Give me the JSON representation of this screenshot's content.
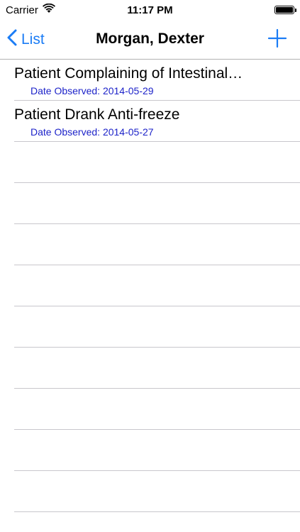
{
  "status_bar": {
    "carrier": "Carrier",
    "time": "11:17 PM",
    "battery_level": 1.0
  },
  "nav": {
    "back_label": "List",
    "title": "Morgan, Dexter",
    "accent_color": "#1b7cf5",
    "add_icon": "plus-icon"
  },
  "observations": [
    {
      "title": "Patient Complaining of Intestinal…",
      "subtitle": "Date Observed: 2014-05-29"
    },
    {
      "title": "Patient Drank Anti-freeze",
      "subtitle": "Date Observed: 2014-05-27"
    }
  ],
  "colors": {
    "subtitle": "#1d23c9",
    "separator": "#c8c7cc"
  }
}
